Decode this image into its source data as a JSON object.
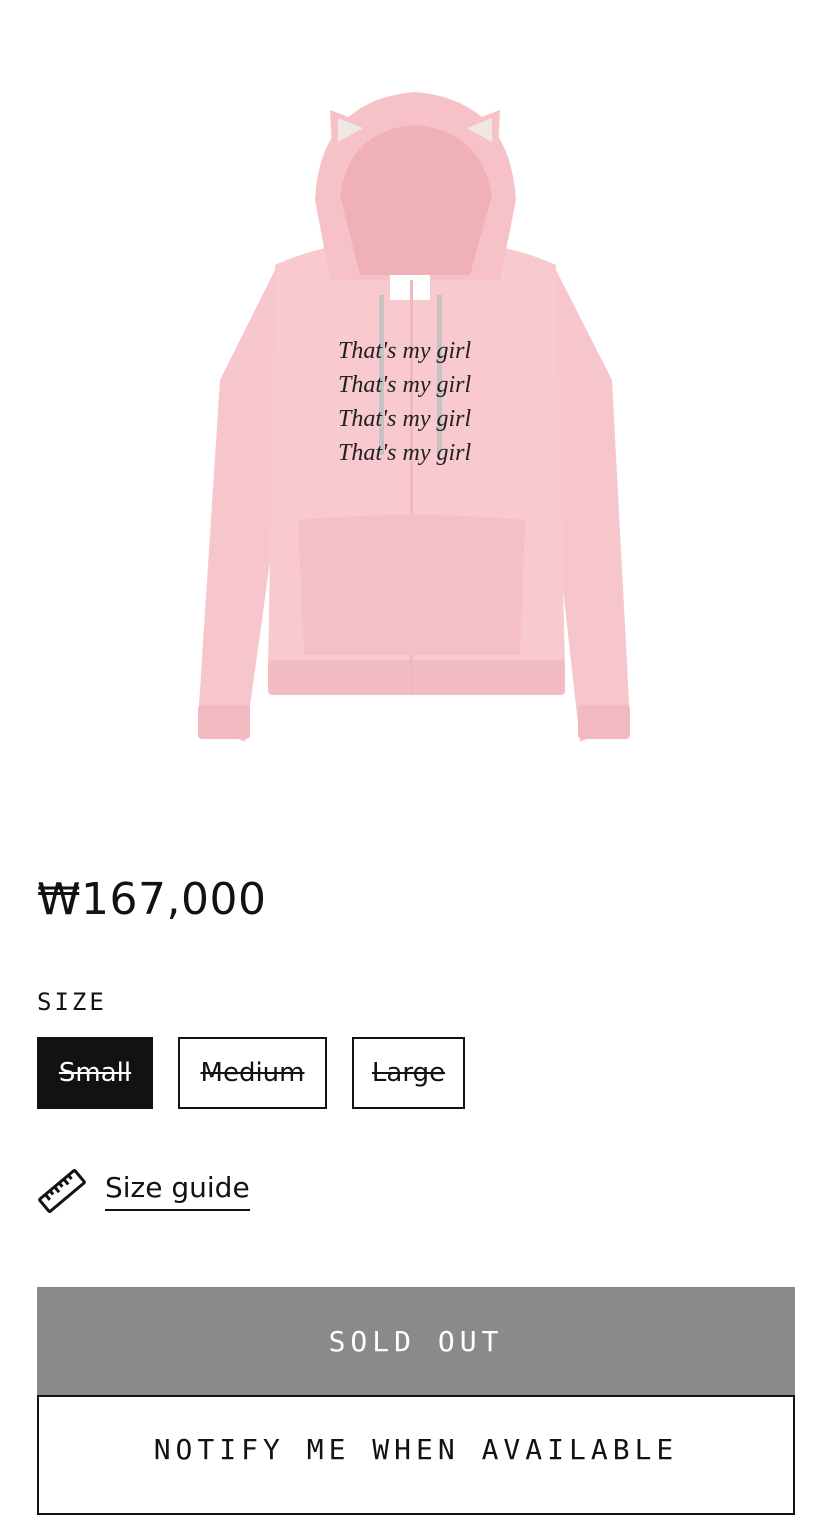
{
  "product": {
    "image_alt": "Pink zip-up hoodie with cat ears",
    "print_lines": [
      "That's my girl",
      "That's my girl",
      "That's my girl",
      "That's my girl"
    ],
    "price": "₩167,000"
  },
  "size_selector": {
    "label": "SIZE",
    "options": [
      {
        "label": "Small",
        "selected": true,
        "available": false
      },
      {
        "label": "Medium",
        "selected": false,
        "available": false
      },
      {
        "label": "Large",
        "selected": false,
        "available": false
      }
    ]
  },
  "size_guide": {
    "label": "Size guide",
    "icon": "ruler-icon"
  },
  "actions": {
    "sold_out_label": "SOLD OUT",
    "notify_label": "NOTIFY ME WHEN AVAILABLE"
  },
  "colors": {
    "hoodie": "#f7c6cc",
    "hoodie_shadow": "#eeb1b8",
    "selected_bg": "#121212",
    "sold_out_bg": "#8a8a8a"
  }
}
